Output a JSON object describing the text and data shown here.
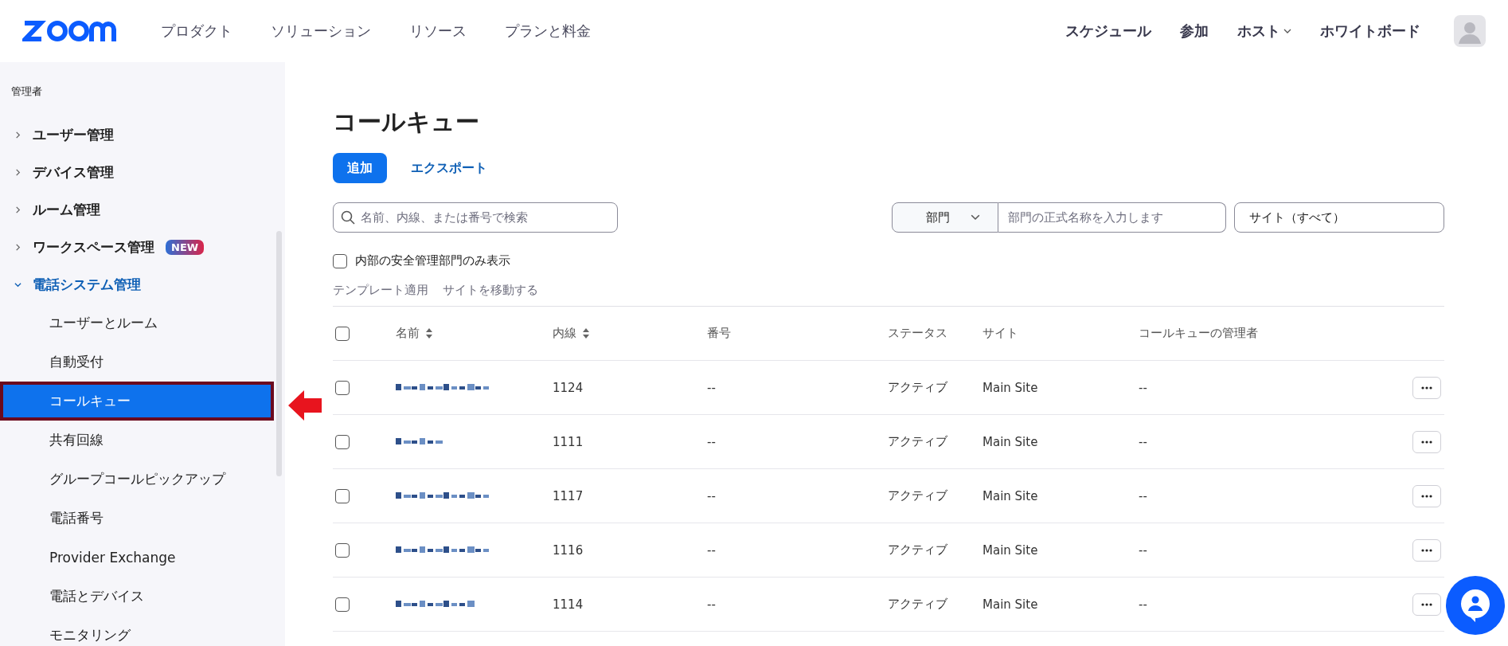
{
  "header": {
    "nav_left": [
      {
        "label": "プロダクト"
      },
      {
        "label": "ソリューション"
      },
      {
        "label": "リソース"
      },
      {
        "label": "プランと料金"
      }
    ],
    "nav_right": [
      {
        "label": "スケジュール",
        "kind": "link"
      },
      {
        "label": "参加",
        "kind": "link"
      },
      {
        "label": "ホスト",
        "kind": "dropdown"
      },
      {
        "label": "ホワイトボード",
        "kind": "link"
      }
    ]
  },
  "sidebar": {
    "heading": "管理者",
    "items": [
      {
        "label": "ユーザー管理",
        "expanded": false
      },
      {
        "label": "デバイス管理",
        "expanded": false
      },
      {
        "label": "ルーム管理",
        "expanded": false
      },
      {
        "label": "ワークスペース管理",
        "expanded": false,
        "badge": "NEW"
      },
      {
        "label": "電話システム管理",
        "expanded": true,
        "children": [
          {
            "label": "ユーザーとルーム",
            "selected": false
          },
          {
            "label": "自動受付",
            "selected": false
          },
          {
            "label": "コールキュー",
            "selected": true
          },
          {
            "label": "共有回線",
            "selected": false
          },
          {
            "label": "グループコールピックアップ",
            "selected": false
          },
          {
            "label": "電話番号",
            "selected": false
          },
          {
            "label": "Provider Exchange",
            "selected": false
          },
          {
            "label": "電話とデバイス",
            "selected": false
          },
          {
            "label": "モニタリング",
            "selected": false
          }
        ]
      }
    ]
  },
  "page": {
    "title": "コールキュー",
    "buttons": [
      {
        "label": "追加",
        "kind": "primary"
      },
      {
        "label": "エクスポート",
        "kind": "link"
      }
    ],
    "search": {
      "placeholder": "名前、内線、または番号で検索"
    },
    "department_select": {
      "value": "部門"
    },
    "department_input": {
      "placeholder": "部門の正式名称を入力します"
    },
    "site_select": {
      "value": "サイト（すべて）"
    },
    "filter_checkbox": {
      "label": "内部の安全管理部門のみ表示",
      "checked": false
    },
    "bulk_actions": [
      "テンプレート適用",
      "サイトを移動する"
    ]
  },
  "table": {
    "select_all": {
      "checked": false
    },
    "columns": [
      {
        "label": "名前",
        "sortable": true
      },
      {
        "label": "内線",
        "sortable": true
      },
      {
        "label": "番号",
        "sortable": false
      },
      {
        "label": "ステータス",
        "sortable": false
      },
      {
        "label": "サイト",
        "sortable": false
      },
      {
        "label": "コールキューの管理者",
        "sortable": false
      }
    ],
    "rows": [
      {
        "checked": false,
        "extension": "1124",
        "number": "--",
        "status": "アクティブ",
        "site": "Main Site",
        "manager": "--"
      },
      {
        "checked": false,
        "extension": "1111",
        "number": "--",
        "status": "アクティブ",
        "site": "Main Site",
        "manager": "--"
      },
      {
        "checked": false,
        "extension": "1117",
        "number": "--",
        "status": "アクティブ",
        "site": "Main Site",
        "manager": "--"
      },
      {
        "checked": false,
        "extension": "1116",
        "number": "--",
        "status": "アクティブ",
        "site": "Main Site",
        "manager": "--"
      },
      {
        "checked": false,
        "extension": "1114",
        "number": "--",
        "status": "アクティブ",
        "site": "Main Site",
        "manager": "--"
      }
    ]
  }
}
